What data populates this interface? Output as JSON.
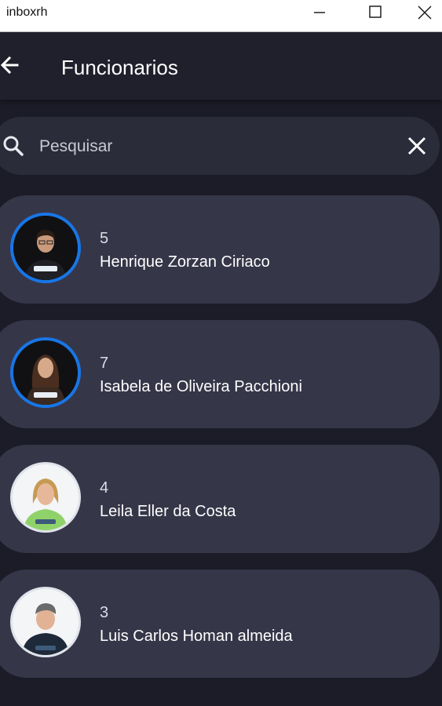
{
  "window": {
    "title": "inboxrh",
    "controls": [
      "minimize-icon",
      "maximize-icon",
      "close-icon"
    ]
  },
  "appbar": {
    "back_icon": "arrow-left-icon",
    "title": "Funcionarios"
  },
  "search": {
    "icon": "search-icon",
    "placeholder": "Pesquisar",
    "value": "",
    "clear_icon": "close-icon"
  },
  "employees": [
    {
      "id": "5",
      "name": "Henrique Zorzan Ciriaco"
    },
    {
      "id": "7",
      "name": "Isabela de Oliveira Pacchioni"
    },
    {
      "id": "4",
      "name": "Leila Eller da Costa"
    },
    {
      "id": "3",
      "name": "Luis Carlos Homan almeida"
    }
  ],
  "colors": {
    "background": "#1b1c27",
    "appbar": "#1f202b",
    "search": "#2b2c3a",
    "card": "#363649",
    "avatar_ring": "#1876e6"
  }
}
